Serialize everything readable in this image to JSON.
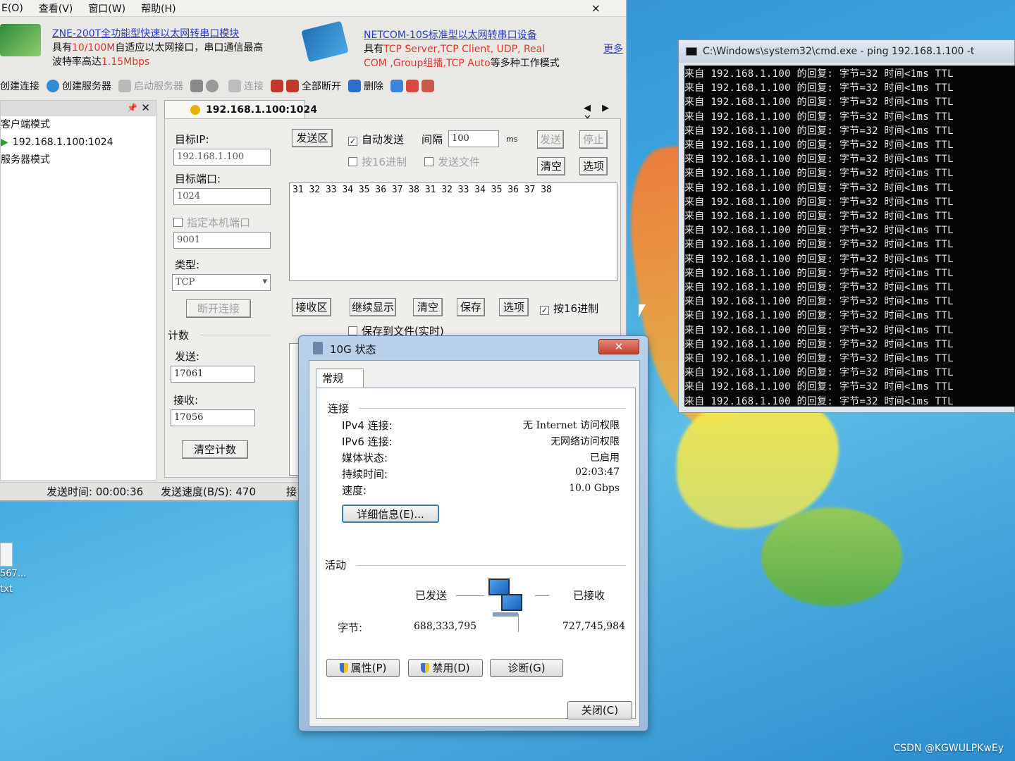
{
  "tool": {
    "menu": [
      "E(O)",
      "查看(V)",
      "窗口(W)",
      "帮助(H)"
    ],
    "close": "×",
    "ad1": {
      "title": "ZNE-200T全功能型快速以太网转串口模块",
      "line2a": "具有",
      "line2b": "10/100M",
      "line2c": "自适应以太网接口，串口通信最高",
      "line3a": "波特率高达",
      "line3b": "1.15Mbps"
    },
    "ad2": {
      "title": "NETCOM-10S标准型以太网转串口设备",
      "line2a": "具有",
      "line2b": "TCP Server,TCP Client, UDP, Real",
      "line3a": "COM ,Group组播,TCP Auto",
      "line3b": "等多种工作模式"
    },
    "more": "更多",
    "toolbar": [
      "创建连接",
      "创建服务器",
      "启动服务器",
      "连接",
      "全部断开",
      "删除"
    ],
    "tree": {
      "client_mode": "客户端模式",
      "connection": "192.168.1.100:1024",
      "server_mode": "服务器模式"
    },
    "tab": "192.168.1.100:1024",
    "tab_ctrls": "◀ ▶ ✕",
    "form": {
      "target_ip_label": "目标IP:",
      "target_ip": "192.168.1.100",
      "target_port_label": "目标端口:",
      "target_port": "1024",
      "local_port_label": "指定本机端口",
      "local_port": "9001",
      "type_label": "类型:",
      "type": "TCP",
      "disconnect": "断开连接",
      "count_label": "计数",
      "send_label": "发送:",
      "send_count": "17061",
      "recv_label": "接收:",
      "recv_count": "17056",
      "clear_count": "清空计数"
    },
    "send": {
      "area_label": "发送区",
      "auto_send": "自动发送",
      "interval_label": "间隔",
      "interval": "100",
      "unit": "ms",
      "send_btn": "发送",
      "stop_btn": "停止",
      "hex_send": "按16进制",
      "send_file": "发送文件",
      "clear": "清空",
      "options": "选项",
      "content": "31 32 33 34 35 36 37 38 31 32 33 34 35 36 37 38"
    },
    "recv": {
      "area_label": "接收区",
      "continue": "继续显示",
      "clear": "清空",
      "save": "保存",
      "options": "选项",
      "hex": "按16进制",
      "save_file": "保存到文件(实时)"
    },
    "status": {
      "send_time": "发送时间: 00:00:36",
      "send_speed": "发送速度(B/S): 470",
      "recv_partial": "接"
    }
  },
  "cmd": {
    "title": "C:\\Windows\\system32\\cmd.exe - ping  192.168.1.100  -t",
    "line": "来自 192.168.1.100 的回复: 字节=32 时间<1ms TTL",
    "line_count": 24
  },
  "dialog": {
    "title": "10G 状态",
    "close": "✕",
    "tab": "常规",
    "connection_section": "连接",
    "rows": [
      {
        "key": "IPv4 连接:",
        "value": "无 Internet 访问权限"
      },
      {
        "key": "IPv6 连接:",
        "value": "无网络访问权限"
      },
      {
        "key": "媒体状态:",
        "value": "已启用"
      },
      {
        "key": "持续时间:",
        "value": "02:03:47"
      },
      {
        "key": "速度:",
        "value": "10.0 Gbps"
      }
    ],
    "details_btn": "详细信息(E)...",
    "activity_section": "活动",
    "sent_label": "已发送",
    "received_label": "已接收",
    "bytes_label": "字节:",
    "bytes_sent": "688,333,795",
    "bytes_received": "727,745,984",
    "properties_btn": "属性(P)",
    "disable_btn": "禁用(D)",
    "diagnose_btn": "诊断(G)",
    "close_btn": "关闭(C)"
  },
  "desktop": {
    "file_label_1": "567...",
    "file_label_2": "txt"
  },
  "watermark": "CSDN @KGWULPKwEy"
}
